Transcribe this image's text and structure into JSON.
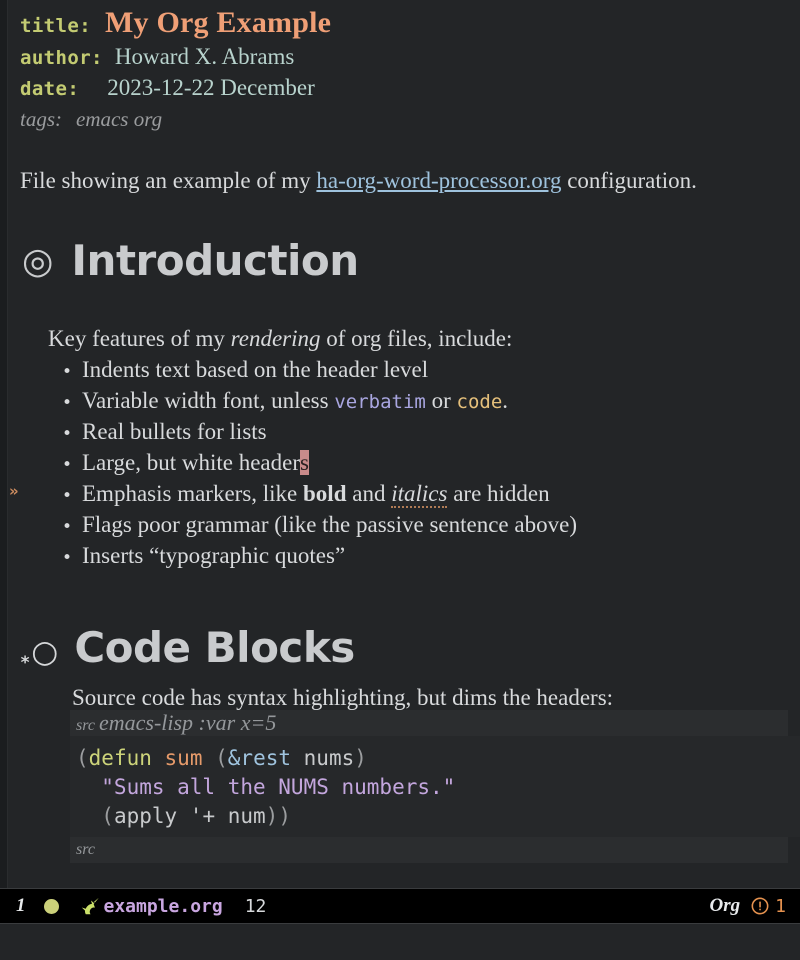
{
  "document": {
    "metadata": [
      {
        "key": "title:",
        "value": "My Org Example",
        "style": "title"
      },
      {
        "key": "author:",
        "value": "Howard X. Abrams",
        "style": "value"
      },
      {
        "key": "date:",
        "value": "2023-12-22 December",
        "style": "value"
      }
    ],
    "tags": {
      "key": "tags:",
      "value": "emacs org"
    },
    "intro_paragraph": {
      "before": "File showing an example of my ",
      "link": "ha-org-word-processor.org",
      "after": " configuration."
    },
    "sections": [
      {
        "bullet": "◎",
        "stars": "",
        "title": "Introduction",
        "lead": {
          "before": "Key features of my ",
          "italic": "rendering",
          "after": " of org files, include:"
        },
        "bullets": [
          {
            "dot": "•",
            "text": "Indents text based on the header level"
          },
          {
            "dot": "•",
            "text": "Variable width font, unless ",
            "verbatim": "verbatim",
            "mid": " or ",
            "code": "code",
            "tail": "."
          },
          {
            "dot": "•",
            "text": "Real bullets for lists"
          },
          {
            "dot": "•",
            "text": "Large, but white header",
            "cursor": "s"
          },
          {
            "dot": "•",
            "text": "Emphasis markers, like ",
            "bold": "bold",
            "mid": " and ",
            "italic": "italics",
            "tail": " are hidden"
          },
          {
            "dot": "•",
            "text": "Flags poor grammar (like the passive sentence above)"
          },
          {
            "dot": "•",
            "text": "Inserts “typographic quotes”"
          }
        ]
      },
      {
        "bullet": "○",
        "stars": "*",
        "title": "Code Blocks",
        "lead": {
          "before": "Source code has syntax highlighting, but dims the headers:"
        }
      }
    ],
    "source_block": {
      "begin_keyword": "src",
      "begin_args": "emacs-lisp :var x=5",
      "end_keyword": "src",
      "lines": [
        [
          {
            "t": "(",
            "c": "c-paren"
          },
          {
            "t": "defun",
            "c": "c-kw"
          },
          {
            "t": " ",
            "c": "c-var"
          },
          {
            "t": "sum",
            "c": "c-fn"
          },
          {
            "t": " ",
            "c": "c-var"
          },
          {
            "t": "(",
            "c": "c-paren"
          },
          {
            "t": "&rest",
            "c": "c-arg"
          },
          {
            "t": " ",
            "c": "c-var"
          },
          {
            "t": "nums",
            "c": "c-var"
          },
          {
            "t": ")",
            "c": "c-paren"
          }
        ],
        [
          {
            "t": "  \"Sums all the NUMS numbers.\"",
            "c": "c-str"
          }
        ],
        [
          {
            "t": "  (",
            "c": "c-paren"
          },
          {
            "t": "apply",
            "c": "c-var"
          },
          {
            "t": " '+ ",
            "c": "c-var"
          },
          {
            "t": "num",
            "c": "c-var"
          },
          {
            "t": "))",
            "c": "c-paren"
          }
        ]
      ]
    },
    "fringe_marker": "»"
  },
  "modeline": {
    "window_number": "1",
    "status_dot_color": "#cbd07a",
    "buffer_name": "example.org",
    "line_number": "12",
    "major_mode": "Org",
    "warning_count": "1",
    "warning_color": "#e5924f"
  }
}
